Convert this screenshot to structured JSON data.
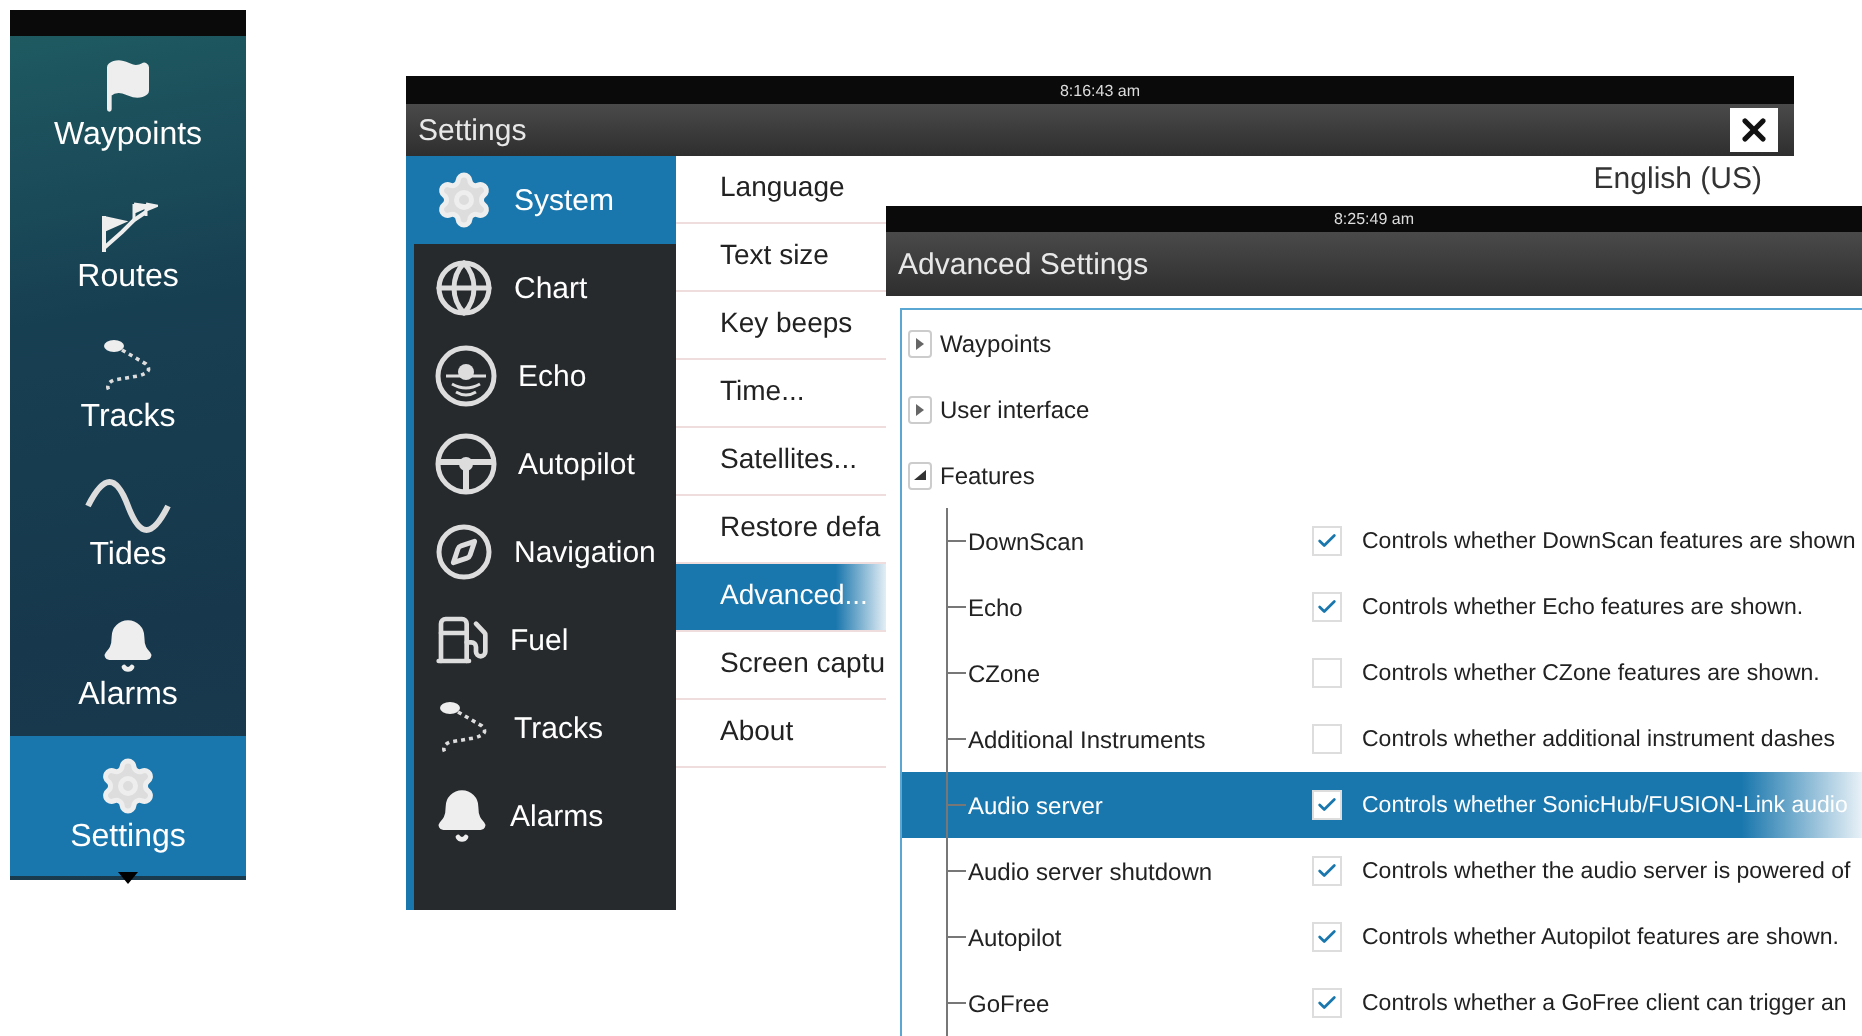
{
  "nav_bar": {
    "items": [
      {
        "label": "Waypoints",
        "selected": false
      },
      {
        "label": "Routes",
        "selected": false
      },
      {
        "label": "Tracks",
        "selected": false
      },
      {
        "label": "Tides",
        "selected": false
      },
      {
        "label": "Alarms",
        "selected": false
      },
      {
        "label": "Settings",
        "selected": true
      }
    ]
  },
  "settings_window": {
    "clock": "8:16:43 am",
    "title": "Settings",
    "categories": [
      {
        "label": "System",
        "selected": true
      },
      {
        "label": "Chart",
        "selected": false
      },
      {
        "label": "Echo",
        "selected": false
      },
      {
        "label": "Autopilot",
        "selected": false
      },
      {
        "label": "Navigation",
        "selected": false
      },
      {
        "label": "Fuel",
        "selected": false
      },
      {
        "label": "Tracks",
        "selected": false
      },
      {
        "label": "Alarms",
        "selected": false
      }
    ],
    "options": [
      {
        "label": "Language",
        "value": "English (US)",
        "selected": false
      },
      {
        "label": "Text size",
        "selected": false
      },
      {
        "label": "Key beeps",
        "selected": false
      },
      {
        "label": "Time...",
        "selected": false
      },
      {
        "label": "Satellites...",
        "selected": false
      },
      {
        "label": "Restore defa",
        "selected": false
      },
      {
        "label": "Advanced...",
        "selected": true
      },
      {
        "label": "Screen captu",
        "selected": false
      },
      {
        "label": "About",
        "selected": false
      }
    ]
  },
  "advanced_window": {
    "clock": "8:25:49 am",
    "title": "Advanced Settings",
    "tree": [
      {
        "label": "Waypoints",
        "expanded": false
      },
      {
        "label": "User interface",
        "expanded": false
      },
      {
        "label": "Features",
        "expanded": true,
        "children": [
          {
            "label": "DownScan",
            "checked": true,
            "selected": false,
            "description": "Controls whether DownScan features are shown"
          },
          {
            "label": "Echo",
            "checked": true,
            "selected": false,
            "description": "Controls whether Echo features are shown."
          },
          {
            "label": "CZone",
            "checked": false,
            "selected": false,
            "description": "Controls whether CZone features are shown."
          },
          {
            "label": "Additional Instruments",
            "checked": false,
            "selected": false,
            "description": "Controls whether additional instrument dashes"
          },
          {
            "label": "Audio server",
            "checked": true,
            "selected": true,
            "description": "Controls whether SonicHub/FUSION-Link audio"
          },
          {
            "label": "Audio server shutdown",
            "checked": true,
            "selected": false,
            "description": "Controls whether the audio server is powered of"
          },
          {
            "label": "Autopilot",
            "checked": true,
            "selected": false,
            "description": "Controls whether Autopilot features are shown."
          },
          {
            "label": "GoFree",
            "checked": true,
            "selected": false,
            "description": "Controls whether a GoFree client can trigger an"
          }
        ]
      }
    ]
  }
}
